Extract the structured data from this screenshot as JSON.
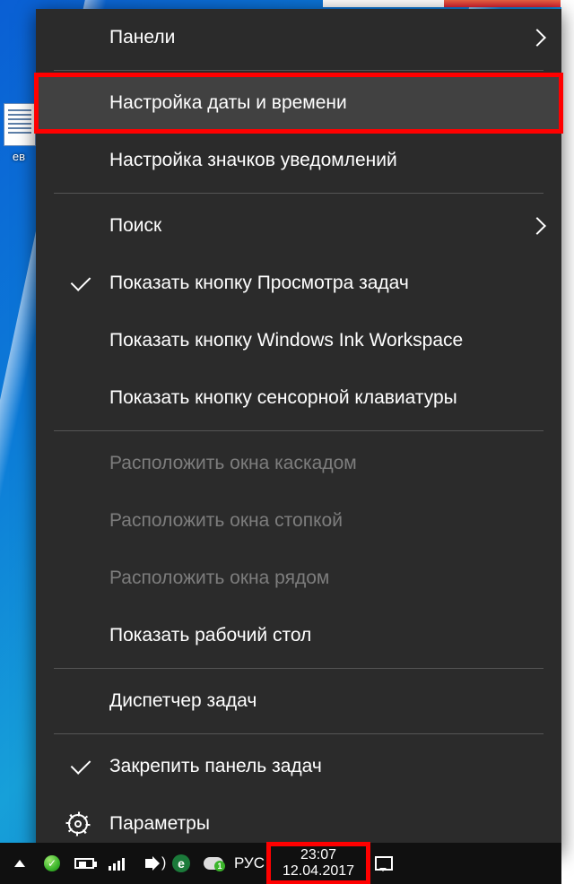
{
  "desktop": {
    "icon_label": "ев"
  },
  "menu": {
    "items": [
      {
        "label": "Панели",
        "submenu": true
      },
      {
        "sep": true
      },
      {
        "label": "Настройка даты и времени",
        "highlight": true
      },
      {
        "label": "Настройка значков уведомлений"
      },
      {
        "sep": true
      },
      {
        "label": "Поиск",
        "submenu": true
      },
      {
        "label": "Показать кнопку Просмотра задач",
        "checked": true
      },
      {
        "label": "Показать кнопку Windows Ink Workspace"
      },
      {
        "label": "Показать кнопку сенсорной клавиатуры"
      },
      {
        "sep": true
      },
      {
        "label": "Расположить окна каскадом",
        "disabled": true
      },
      {
        "label": "Расположить окна стопкой",
        "disabled": true
      },
      {
        "label": "Расположить окна рядом",
        "disabled": true
      },
      {
        "label": "Показать рабочий стол"
      },
      {
        "sep": true
      },
      {
        "label": "Диспетчер задач"
      },
      {
        "sep": true
      },
      {
        "label": "Закрепить панель задач",
        "checked": true
      },
      {
        "label": "Параметры",
        "icon": "gear"
      }
    ]
  },
  "taskbar": {
    "lang": "РУС",
    "time": "23:07",
    "date": "12.04.2017",
    "cloud_badge": "1"
  }
}
